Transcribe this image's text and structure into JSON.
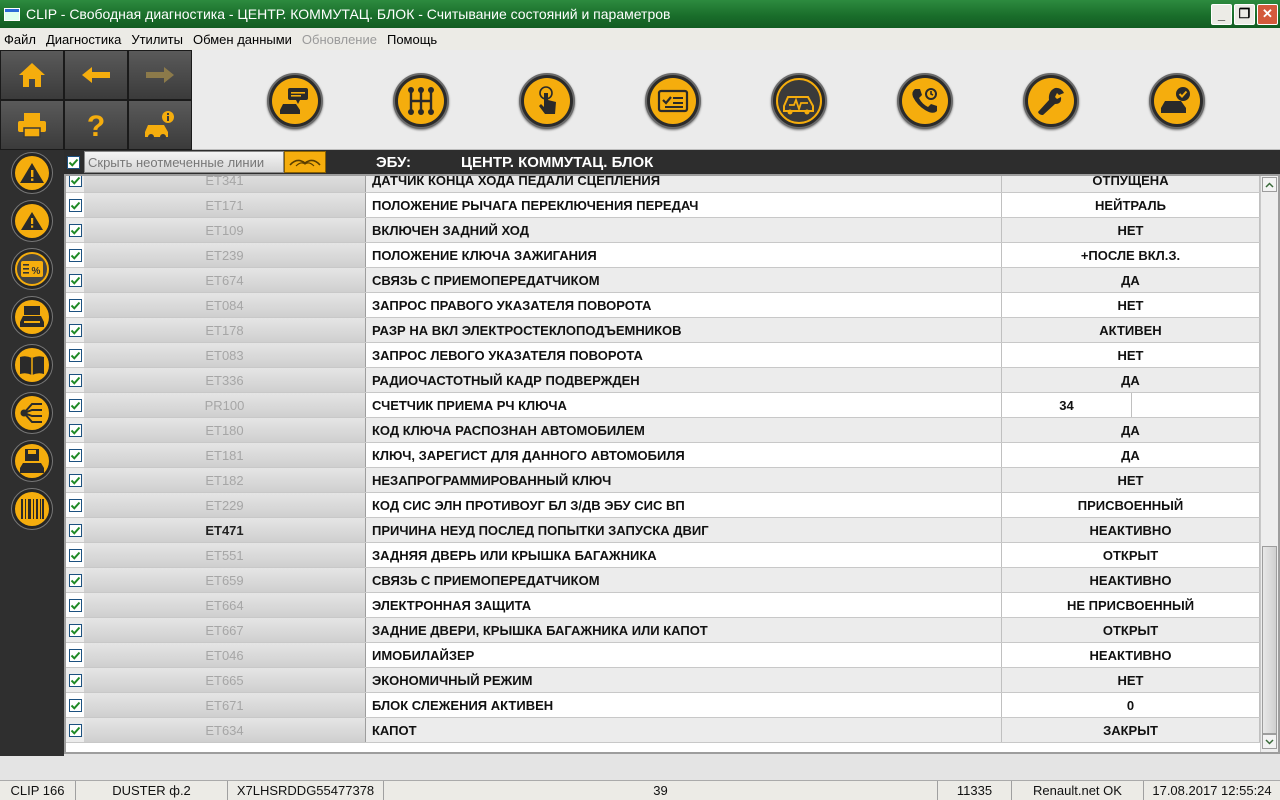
{
  "window": {
    "title": "CLIP - Свободная диагностика - ЦЕНТР. КОММУТАЦ. БЛОК - Считывание состояний и параметров",
    "minimize": "_",
    "maximize": "❐",
    "close": "✕"
  },
  "menu": [
    {
      "label": "Файл",
      "disabled": false
    },
    {
      "label": "Диагностика",
      "disabled": false
    },
    {
      "label": "Утилиты",
      "disabled": false
    },
    {
      "label": "Обмен данными",
      "disabled": false
    },
    {
      "label": "Обновление",
      "disabled": true
    },
    {
      "label": "Помощь",
      "disabled": false
    }
  ],
  "toolbar": {
    "grid_icons": [
      "home-icon",
      "back-arrow-icon",
      "forward-arrow-icon",
      "printer-icon",
      "help-icon",
      "vehicle-info-icon"
    ],
    "round_icons": [
      "vehicle-chat-icon",
      "gearbox-icon",
      "touch-icon",
      "checklist-icon",
      "diagnostic-car-icon",
      "phone-support-icon",
      "wrench-icon",
      "vehicle-check-icon"
    ],
    "active_round": 4
  },
  "sidebar": {
    "icons": [
      "warning-icon",
      "warning-small-icon",
      "parameters-percent-icon",
      "vehicle-screen-icon",
      "manual-book-icon",
      "network-icon",
      "vehicle-save-icon",
      "barcode-icon"
    ],
    "active": 2
  },
  "filter": {
    "hide_unchecked_label": "Скрыть неотмеченные линии",
    "ecu_label": "ЭБУ:",
    "ecu_value": "ЦЕНТР. КОММУТАЦ. БЛОК"
  },
  "rows": [
    {
      "code": "ET341",
      "name": "ДАТЧИК КОНЦА ХОДА ПЕДАЛИ СЦЕПЛЕНИЯ",
      "value": "ОТПУЩЕНА",
      "bold": false
    },
    {
      "code": "ET171",
      "name": "ПОЛОЖЕНИЕ РЫЧАГА ПЕРЕКЛЮЧЕНИЯ ПЕРЕДАЧ",
      "value": "НЕЙТРАЛЬ",
      "bold": false
    },
    {
      "code": "ET109",
      "name": "ВКЛЮЧЕН ЗАДНИЙ ХОД",
      "value": "НЕТ",
      "bold": false
    },
    {
      "code": "ET239",
      "name": "ПОЛОЖЕНИЕ КЛЮЧА ЗАЖИГАНИЯ",
      "value": "+ПОСЛЕ ВКЛ.З.",
      "bold": false
    },
    {
      "code": "ET674",
      "name": "СВЯЗЬ С ПРИЕМОПЕРЕДАТЧИКОМ",
      "value": "ДА",
      "bold": false
    },
    {
      "code": "ET084",
      "name": "ЗАПРОС ПРАВОГО УКАЗАТЕЛЯ ПОВОРОТА",
      "value": "НЕТ",
      "bold": false
    },
    {
      "code": "ET178",
      "name": "РАЗР НА ВКЛ ЭЛЕКТРОСТЕКЛОПОДЪЕМНИКОВ",
      "value": "АКТИВЕН",
      "bold": false
    },
    {
      "code": "ET083",
      "name": "ЗАПРОС ЛЕВОГО УКАЗАТЕЛЯ ПОВОРОТА",
      "value": "НЕТ",
      "bold": false
    },
    {
      "code": "ET336",
      "name": "РАДИОЧАСТОТНЫЙ КАДР ПОДВЕРЖДЕН",
      "value": "ДА",
      "bold": false
    },
    {
      "code": "PR100",
      "name": "СЧЕТЧИК ПРИЕМА РЧ КЛЮЧА",
      "value": "34",
      "bold": false,
      "split": true
    },
    {
      "code": "ET180",
      "name": "КОД КЛЮЧА РАСПОЗНАН АВТОМОБИЛЕМ",
      "value": "ДА",
      "bold": false
    },
    {
      "code": "ET181",
      "name": "КЛЮЧ, ЗАРЕГИСТ ДЛЯ ДАННОГО АВТОМОБИЛЯ",
      "value": "ДА",
      "bold": false
    },
    {
      "code": "ET182",
      "name": "НЕЗАПРОГРАММИРОВАННЫЙ КЛЮЧ",
      "value": "НЕТ",
      "bold": false
    },
    {
      "code": "ET229",
      "name": "КОД СИС ЭЛН ПРОТИВОУГ БЛ З/ДВ ЭБУ СИС ВП",
      "value": "ПРИСВОЕННЫЙ",
      "bold": false
    },
    {
      "code": "ET471",
      "name": "ПРИЧИНА НЕУД ПОСЛЕД ПОПЫТКИ ЗАПУСКА ДВИГ",
      "value": "НЕАКТИВНО",
      "bold": true
    },
    {
      "code": "ET551",
      "name": "ЗАДНЯЯ ДВЕРЬ ИЛИ КРЫШКА БАГАЖНИКА",
      "value": "ОТКРЫТ",
      "bold": false
    },
    {
      "code": "ET659",
      "name": "СВЯЗЬ С ПРИЕМОПЕРЕДАТЧИКОМ",
      "value": "НЕАКТИВНО",
      "bold": false
    },
    {
      "code": "ET664",
      "name": "ЭЛЕКТРОННАЯ ЗАЩИТА",
      "value": "НЕ ПРИСВОЕННЫЙ",
      "bold": false
    },
    {
      "code": "ET667",
      "name": "ЗАДНИЕ ДВЕРИ, КРЫШКА БАГАЖНИКА ИЛИ КАПОТ",
      "value": "ОТКРЫТ",
      "bold": false
    },
    {
      "code": "ET046",
      "name": "ИМОБИЛАЙЗЕР",
      "value": "НЕАКТИВНО",
      "bold": false
    },
    {
      "code": "ET665",
      "name": "ЭКОНОМИЧНЫЙ РЕЖИМ",
      "value": "НЕТ",
      "bold": false
    },
    {
      "code": "ET671",
      "name": "БЛОК СЛЕЖЕНИЯ АКТИВЕН",
      "value": "0",
      "bold": false
    },
    {
      "code": "ET634",
      "name": "КАПОТ",
      "value": "ЗАКРЫТ",
      "bold": false
    }
  ],
  "status": {
    "version": "CLIP 166",
    "vehicle": "DUSTER ф.2",
    "vin": "X7LHSRDDG55477378",
    "count": "39",
    "code": "11335",
    "network": "Renault.net OK",
    "datetime": "17.08.2017 12:55:24"
  },
  "colors": {
    "accent": "#f5ad0d",
    "titlebar": "#1a6e2b",
    "dark_panel": "#2d2d2d"
  }
}
